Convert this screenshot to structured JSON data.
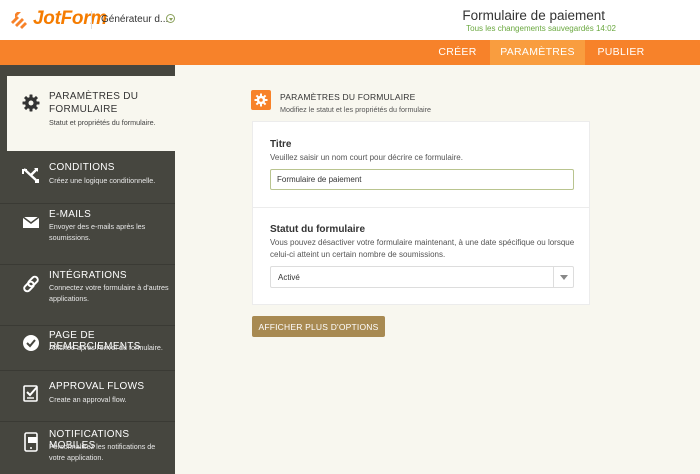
{
  "app": {
    "logo_text": "JotForm",
    "builder_name": "Générateur d...",
    "form_title": "Formulaire de paiement",
    "save_status": "Tous les changements sauvegardés 14:02"
  },
  "tabs": [
    {
      "label": "CRÉER",
      "active": false
    },
    {
      "label": "PARAMÈTRES",
      "active": true
    },
    {
      "label": "PUBLIER",
      "active": false
    }
  ],
  "sidebar": {
    "items": [
      {
        "icon": "gear-icon",
        "title": "PARAMÈTRES DU FORMULAIRE",
        "desc": "Statut et propriétés du formulaire.",
        "active": true
      },
      {
        "icon": "conditions-icon",
        "title": "CONDITIONS",
        "desc": "Créez une logique conditionnelle.",
        "active": false
      },
      {
        "icon": "envelope-icon",
        "title": "E-MAILS",
        "desc": "Envoyer des e-mails après les soumissions.",
        "active": false
      },
      {
        "icon": "link-icon",
        "title": "INTÉGRATIONS",
        "desc": "Connectez votre formulaire à d'autres applications.",
        "active": false
      },
      {
        "icon": "check-circle-icon",
        "title": "PAGE DE REMERCIEMENTS",
        "desc": "Affichée après l'envoi du formulaire.",
        "active": false
      },
      {
        "icon": "approval-icon",
        "title": "APPROVAL FLOWS",
        "desc": "Create an approval flow.",
        "active": false
      },
      {
        "icon": "mobile-notification-icon",
        "title": "NOTIFICATIONS MOBILES",
        "desc": "Personnalisez les notifications de votre application.",
        "active": false
      }
    ]
  },
  "section": {
    "title": "PARAMÈTRES DU FORMULAIRE",
    "subtitle": "Modifiez le statut et les propriétés du formulaire"
  },
  "fields": {
    "title_label": "Titre",
    "title_help": "Veuillez saisir un nom court pour décrire ce formulaire.",
    "title_value": "Formulaire de paiement",
    "status_label": "Statut du formulaire",
    "status_help": "Vous pouvez désactiver votre formulaire maintenant, à une date spécifique ou lorsque celui-ci atteint un certain nombre de soumissions.",
    "status_value": "Activé"
  },
  "more_options_label": "AFFICHER PLUS D'OPTIONS",
  "colors": {
    "brand_orange": "#f7822a",
    "sidebar_bg": "#46463f",
    "page_bg": "#f8f7ef",
    "button_brown": "#a88a52",
    "save_green": "#6aa83f"
  }
}
